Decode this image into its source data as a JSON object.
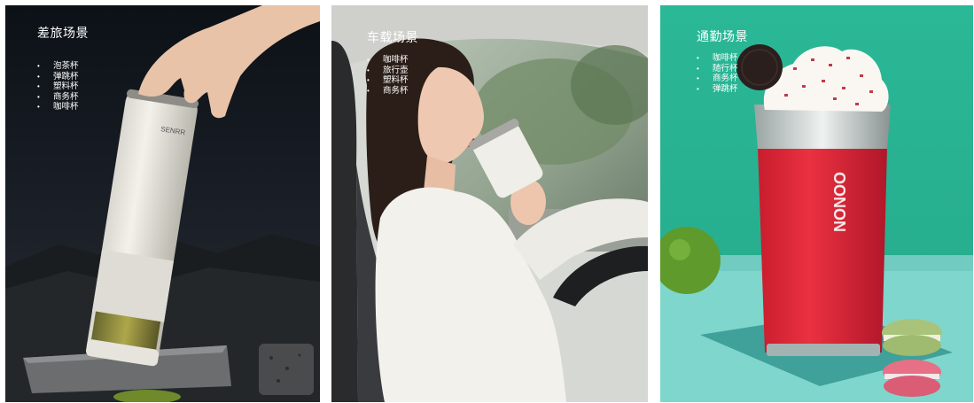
{
  "panels": [
    {
      "title": "差旅场景",
      "items": [
        "泡茶杯",
        "弹跳杯",
        "塑料杯",
        "商务杯",
        "咖啡杯"
      ]
    },
    {
      "title": "车载场景",
      "items": [
        "咖啡杯",
        "旅行壶",
        "塑料杯",
        "商务杯"
      ]
    },
    {
      "title": "通勤场景",
      "items": [
        "咖啡杯",
        "随行杯",
        "商务杯",
        "弹跳杯"
      ]
    }
  ],
  "brand_marks": {
    "bottle_logo": "SENRR",
    "cup_logo": "OONON"
  },
  "colors": {
    "panel1_bg": "#0f1419",
    "panel2_bg": "#c9d2c8",
    "panel3_bg": "#2fb89a",
    "cup_red": "#e0283a",
    "white_text": "#ffffff"
  }
}
